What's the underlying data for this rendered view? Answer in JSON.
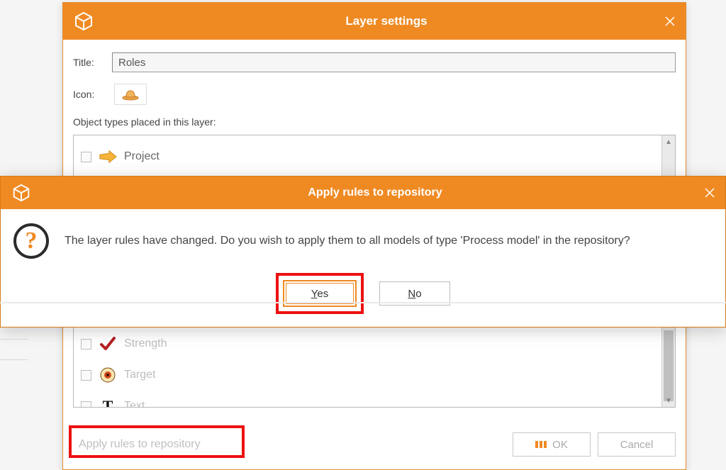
{
  "bg": {
    "title": "Layer settings",
    "title_label": "Title:",
    "title_value": "Roles",
    "icon_label": "Icon:",
    "object_types_caption": "Object types placed in this layer:",
    "items": [
      {
        "label": "Project"
      },
      {
        "label": "Strength"
      },
      {
        "label": "Target"
      },
      {
        "label": "Text"
      }
    ],
    "apply_link": "Apply rules to repository",
    "ok": "OK",
    "cancel": "Cancel"
  },
  "modal": {
    "title": "Apply rules to repository",
    "message": "The layer rules have changed. Do you wish to apply them to all models of type 'Process model' in the repository?",
    "yes_u": "Y",
    "yes_rest": "es",
    "no_u": "N",
    "no_rest": "o"
  }
}
